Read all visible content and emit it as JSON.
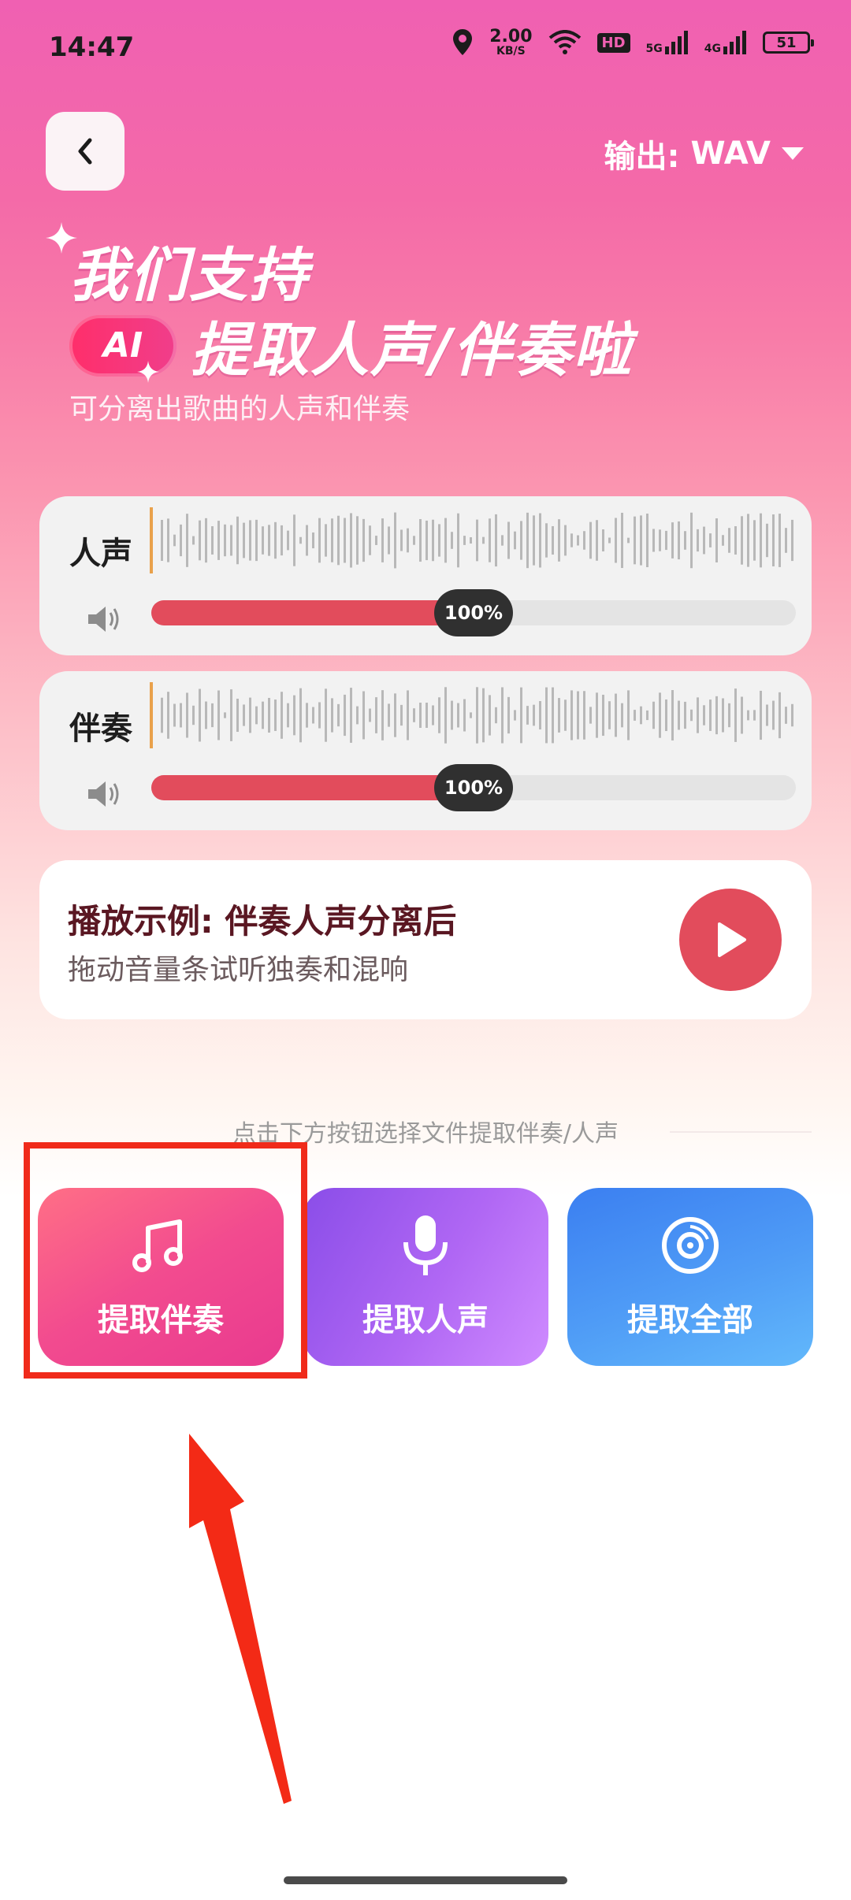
{
  "status_bar": {
    "time": "14:47",
    "net_speed_value": "2.00",
    "net_speed_unit": "KB/S",
    "hd_badge": "HD",
    "sim1_label": "5G",
    "sim2_label": "4G",
    "battery": "51"
  },
  "header": {
    "output_label": "输出:",
    "output_format": "WAV"
  },
  "hero": {
    "line1": "我们支持",
    "ai_badge": "AI",
    "line2": "提取人声/伴奏啦",
    "subtitle": "可分离出歌曲的人声和伴奏"
  },
  "tracks": [
    {
      "label": "人声",
      "volume_text": "100%",
      "slider_level": 0.5
    },
    {
      "label": "伴奏",
      "volume_text": "100%",
      "slider_level": 0.5
    }
  ],
  "example": {
    "title": "播放示例: 伴奏人声分离后",
    "subtitle": "拖动音量条试听独奏和混响"
  },
  "hint": "点击下方按钮选择文件提取伴奏/人声",
  "actions": [
    {
      "label": "提取伴奏"
    },
    {
      "label": "提取人声"
    },
    {
      "label": "提取全部"
    }
  ],
  "colors": {
    "accent": "#e24c5c",
    "annotation": "#f02b1b"
  }
}
